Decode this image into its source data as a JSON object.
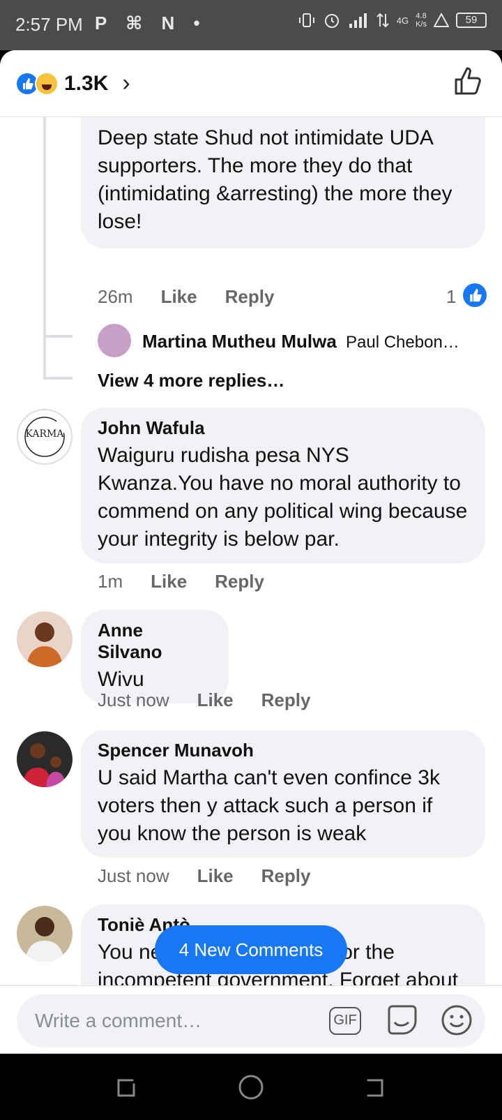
{
  "status_bar": {
    "time": "2:57 PM",
    "left_icons": "P ⌘ N •",
    "network": "4G",
    "speed_value": "4.8",
    "speed_unit": "K/s",
    "battery": "59"
  },
  "header": {
    "reaction_count": "1.3K",
    "chevron": "›",
    "icons": [
      "like-reaction-icon",
      "haha-reaction-icon",
      "thumb-up-icon"
    ]
  },
  "comments": {
    "c1": {
      "text": "Deep state Shud not intimidate UDA supporters. The more they do that (intimidating &arresting) the more they lose!",
      "time": "26m",
      "like": "Like",
      "reply": "Reply",
      "like_count": "1"
    },
    "reply_preview": {
      "author": "Martina Mutheu Mulwa",
      "snippet": "Paul Chebon…",
      "view_more": "View 4 more replies…"
    },
    "c2": {
      "avatar_text": "KARMA",
      "author": "John Wafula",
      "text": "Waiguru rudisha pesa NYS Kwanza.You have no moral authority to commend on any political wing because your integrity is below par.",
      "time": "1m",
      "like": "Like",
      "reply": "Reply"
    },
    "c3": {
      "author": "Anne Silvano",
      "text": "Wivu",
      "time": "Just now",
      "like": "Like",
      "reply": "Reply"
    },
    "c4": {
      "author": "Spencer Munavoh",
      "text": "U said Martha can't even confince 3k voters then y attack such a person if you know the person is weak",
      "time": "Just now",
      "like": "Like",
      "reply": "Reply"
    },
    "c5": {
      "author": "Toniè Antò",
      "text": "You need to feel the heat for the incompetent government. Forget about the ghost worker"
    }
  },
  "new_comments_label": "4 New Comments",
  "composer": {
    "placeholder": "Write a comment…",
    "gif_label": "GIF"
  },
  "colors": {
    "accent": "#1877f2",
    "bubble": "#f0f2f5",
    "muted": "#65676b"
  }
}
